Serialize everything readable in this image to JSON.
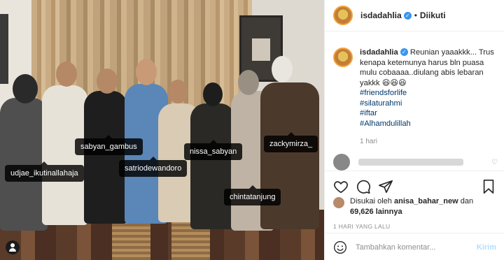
{
  "photo": {
    "tags": [
      {
        "id": "udjae",
        "label": "udjae_ikutinallahaja"
      },
      {
        "id": "sabyan",
        "label": "sabyan_gambus"
      },
      {
        "id": "satrio",
        "label": "satriodewandoro"
      },
      {
        "id": "nissa",
        "label": "nissa_sabyan"
      },
      {
        "id": "chinta",
        "label": "chintatanjung"
      },
      {
        "id": "zacky",
        "label": "zackymirza_"
      }
    ]
  },
  "header": {
    "username": "isdadahlia",
    "separator": "•",
    "follow_status": "Diikuti"
  },
  "caption": {
    "username": "isdadahlia",
    "text": "Reunian yaaakkk... Trus kenapa ketemunya harus bln puasa mulu cobaaaa..diulang abis lebaran yakkk 😆😆😆",
    "hashtags": [
      "#friendsforlife",
      "#silaturahmi",
      "#iftar",
      "#Alhamdulillah"
    ],
    "time": "1 hari"
  },
  "likes": {
    "prefix": "Disukai oleh",
    "user": "anisa_bahar_new",
    "conj": "dan",
    "count": "69,626 lainnya"
  },
  "posted_ago": "1 HARI YANG LALU",
  "comment_box": {
    "placeholder": "Tambahkan komentar...",
    "post_label": "Kirim"
  },
  "colors": {
    "link": "#00376b",
    "verified": "#3897f0",
    "post_disabled": "#b2dffc"
  }
}
